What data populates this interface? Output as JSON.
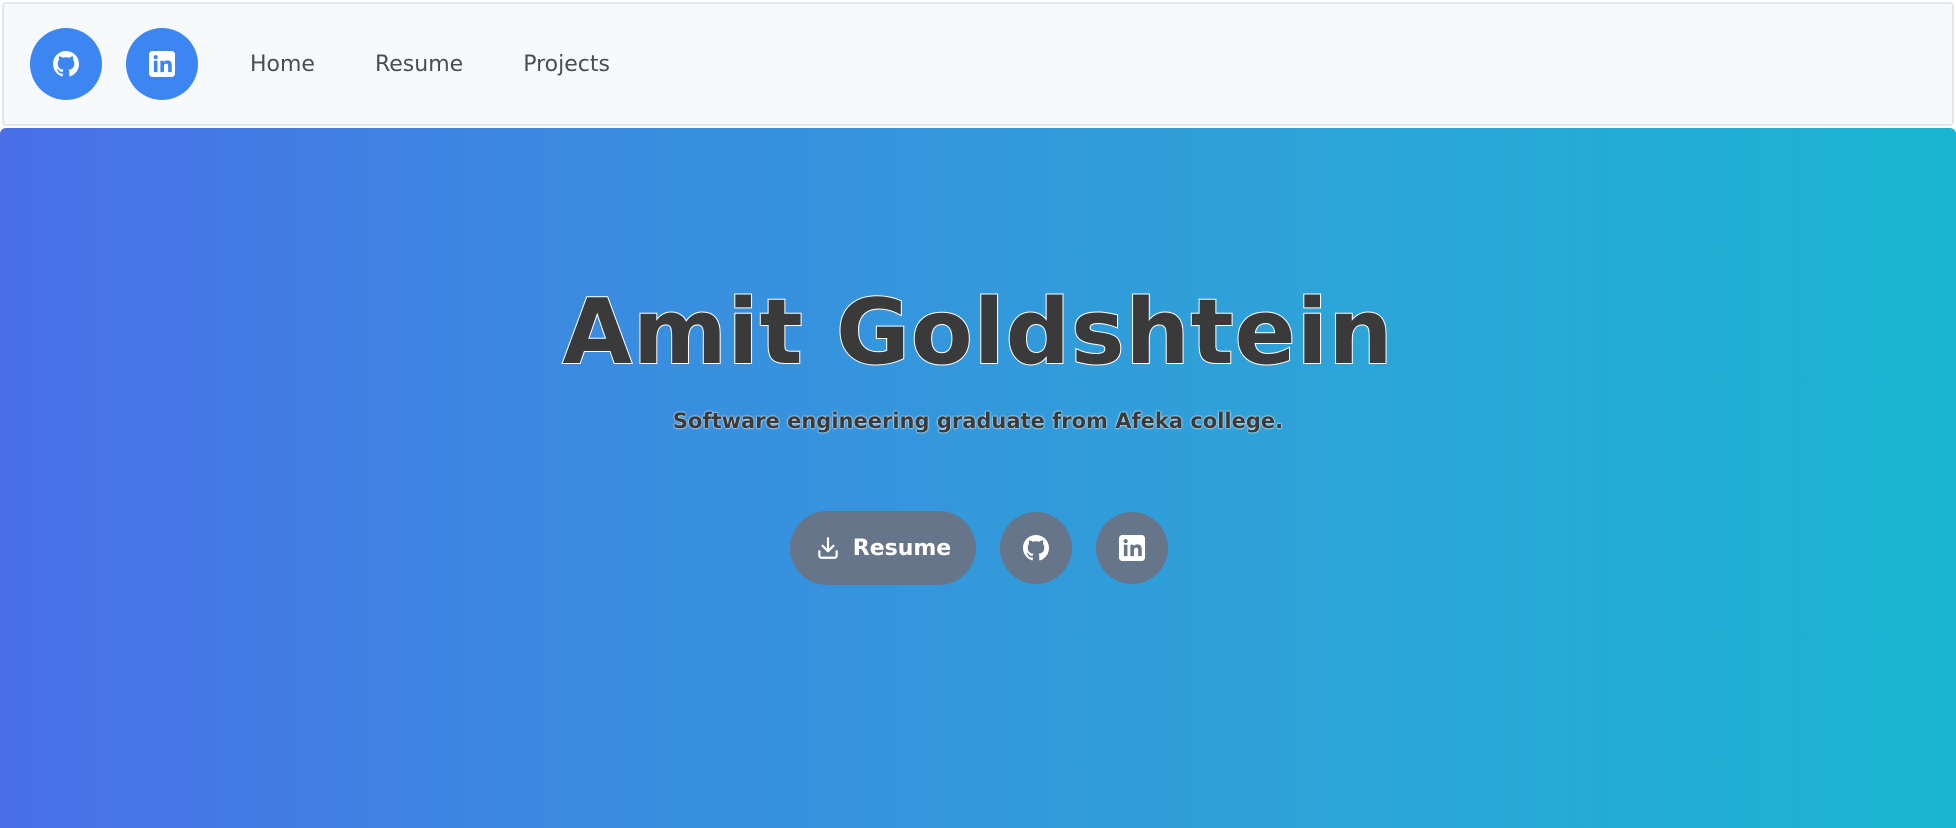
{
  "navbar": {
    "icons": [
      {
        "name": "github-icon"
      },
      {
        "name": "linkedin-icon"
      }
    ],
    "links": [
      "Home",
      "Resume",
      "Projects"
    ],
    "accent_color": "#3b86f0"
  },
  "hero": {
    "title": "Amit Goldshtein",
    "subtitle": "Software engineering graduate from Afeka college.",
    "resume_button_label": "Resume",
    "button_color": "#66758a",
    "gradient_colors": [
      "#4a6fe8",
      "#1ab5d2"
    ]
  }
}
